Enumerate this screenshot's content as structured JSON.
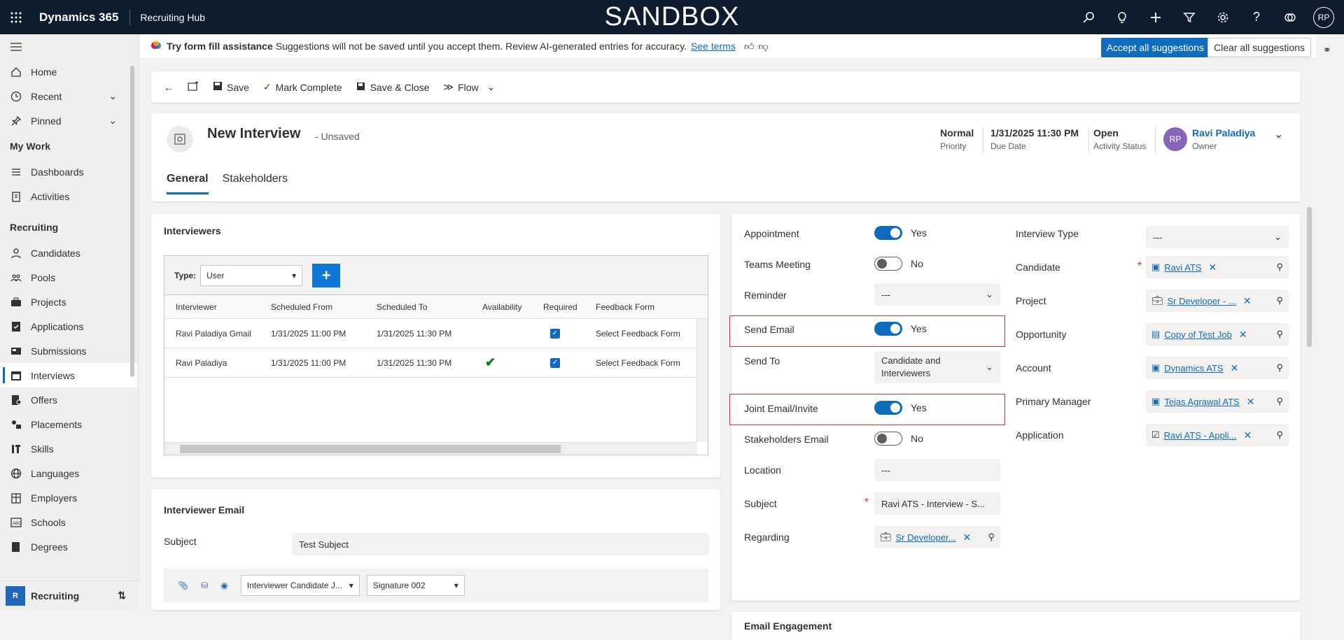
{
  "topbar": {
    "brand": "Dynamics 365",
    "app": "Recruiting Hub",
    "environment": "SANDBOX",
    "user_initials": "RP",
    "icons": [
      "search-icon",
      "lightbulb-icon",
      "plus-icon",
      "filter-icon",
      "gear-icon",
      "help-icon",
      "copilot-icon"
    ]
  },
  "sidebar": {
    "items_top": [
      {
        "label": "Home",
        "icon": "home-icon"
      },
      {
        "label": "Recent",
        "icon": "clock-icon"
      },
      {
        "label": "Pinned",
        "icon": "pin-icon"
      }
    ],
    "my_work_heading": "My Work",
    "my_work": [
      {
        "label": "Dashboards",
        "icon": "dashboard-icon"
      },
      {
        "label": "Activities",
        "icon": "clipboard-icon"
      }
    ],
    "recruiting_heading": "Recruiting",
    "recruiting": [
      {
        "label": "Candidates",
        "icon": "person-icon"
      },
      {
        "label": "Pools",
        "icon": "group-icon"
      },
      {
        "label": "Projects",
        "icon": "briefcase-icon"
      },
      {
        "label": "Applications",
        "icon": "check-document-icon"
      },
      {
        "label": "Submissions",
        "icon": "submission-icon"
      },
      {
        "label": "Interviews",
        "icon": "calendar-icon"
      },
      {
        "label": "Offers",
        "icon": "offer-icon"
      },
      {
        "label": "Placements",
        "icon": "placement-icon"
      },
      {
        "label": "Skills",
        "icon": "skills-icon"
      },
      {
        "label": "Languages",
        "icon": "globe-icon"
      },
      {
        "label": "Employers",
        "icon": "building-icon"
      },
      {
        "label": "Schools",
        "icon": "school-icon"
      },
      {
        "label": "Degrees",
        "icon": "degree-icon"
      }
    ],
    "active": "Interviews",
    "area_badge": "R",
    "area_label": "Recruiting"
  },
  "assist": {
    "title": "Try form fill assistance",
    "text": "Suggestions will not be saved until you accept them. Review AI-generated entries for accuracy.",
    "link": "See terms",
    "accept": "Accept all suggestions",
    "clear": "Clear all suggestions"
  },
  "commands": {
    "save": "Save",
    "mark_complete": "Mark Complete",
    "save_close": "Save & Close",
    "flow": "Flow"
  },
  "header": {
    "title": "New Interview",
    "status": "- Unsaved",
    "priority_value": "Normal",
    "priority_label": "Priority",
    "due_value": "1/31/2025 11:30 PM",
    "due_label": "Due Date",
    "activity_value": "Open",
    "activity_label": "Activity Status",
    "owner_initials": "RP",
    "owner_name": "Ravi Paladiya",
    "owner_label": "Owner",
    "tabs": [
      "General",
      "Stakeholders"
    ]
  },
  "interviewers": {
    "title": "Interviewers",
    "type_label": "Type:",
    "type_value": "User",
    "add": "+",
    "columns": [
      "Interviewer",
      "Scheduled From",
      "Scheduled To",
      "Availability",
      "Required",
      "Feedback Form"
    ],
    "rows": [
      {
        "interviewer": "Ravi Paladiya Gmail",
        "from": "1/31/2025 11:00 PM",
        "to": "1/31/2025 11:30 PM",
        "available": false,
        "required": true,
        "feedback": "Select Feedback Form"
      },
      {
        "interviewer": "Ravi Paladiya",
        "from": "1/31/2025 11:00 PM",
        "to": "1/31/2025 11:30 PM",
        "available": true,
        "required": true,
        "feedback": "Select Feedback Form"
      }
    ]
  },
  "interviewer_email": {
    "title": "Interviewer Email",
    "subject_label": "Subject",
    "subject_value": "Test Subject",
    "template_value": "Interviewer Candidate J...",
    "signature_value": "Signature 002"
  },
  "form_left": {
    "appointment": {
      "label": "Appointment",
      "value": "Yes"
    },
    "teams": {
      "label": "Teams Meeting",
      "value": "No"
    },
    "reminder": {
      "label": "Reminder",
      "value": "---"
    },
    "send_email": {
      "label": "Send Email",
      "value": "Yes"
    },
    "send_to": {
      "label": "Send To",
      "value_line1": "Candidate and",
      "value_line2": "Interviewers"
    },
    "joint": {
      "label": "Joint Email/Invite",
      "value": "Yes"
    },
    "stakeholders_email": {
      "label": "Stakeholders Email",
      "value": "No"
    },
    "location": {
      "label": "Location",
      "value": "---"
    },
    "subject": {
      "label": "Subject",
      "value": "Ravi ATS - Interview - S..."
    },
    "regarding": {
      "label": "Regarding",
      "value": "Sr Developer..."
    }
  },
  "form_right": {
    "interview_type": {
      "label": "Interview Type",
      "value": "---"
    },
    "candidate": {
      "label": "Candidate",
      "value": "Ravi ATS"
    },
    "project": {
      "label": "Project",
      "value": "Sr Developer - ..."
    },
    "opportunity": {
      "label": "Opportunity",
      "value": "Copy of Test Job"
    },
    "account": {
      "label": "Account",
      "value": "Dynamics ATS"
    },
    "primary_manager": {
      "label": "Primary Manager",
      "value": "Tejas Agrawal ATS"
    },
    "application": {
      "label": "Application",
      "value": "Ravi ATS - Appli..."
    }
  },
  "email_engagement": {
    "title": "Email Engagement"
  },
  "colors": {
    "accent": "#0f6cbd",
    "topbar": "#0f1b2e",
    "highlight": "#d13438"
  }
}
